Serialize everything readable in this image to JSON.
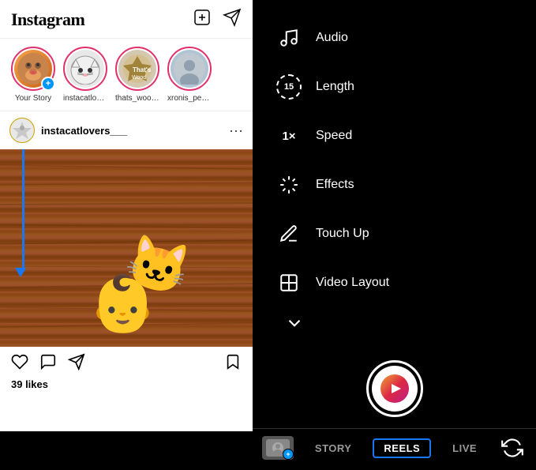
{
  "left": {
    "logo": "Instagram",
    "topbar": {
      "new_post_icon": "plus-square-icon",
      "send_icon": "send-icon"
    },
    "stories": [
      {
        "id": "your-story",
        "label": "Your Story",
        "has_ring": true,
        "has_add": true,
        "emoji": "🐕"
      },
      {
        "id": "instacatlovers",
        "label": "instacatlovers...",
        "has_ring": true,
        "has_add": false,
        "emoji": "🐱"
      },
      {
        "id": "thats_wood",
        "label": "thats_wood...",
        "has_ring": true,
        "has_add": false,
        "emoji": "⛏"
      },
      {
        "id": "xronis_pegk",
        "label": "xronis_pegk_...",
        "has_ring": true,
        "has_add": false,
        "emoji": "👤"
      }
    ],
    "post": {
      "username": "instacatlovers___",
      "likes": "39 likes"
    }
  },
  "right": {
    "controls": [
      {
        "id": "audio",
        "label": "Audio",
        "icon": "music-icon"
      },
      {
        "id": "length",
        "label": "Length",
        "icon": "length-icon",
        "value": "15"
      },
      {
        "id": "speed",
        "label": "Speed",
        "icon": "speed-icon",
        "value": "1×"
      },
      {
        "id": "effects",
        "label": "Effects",
        "icon": "effects-icon"
      },
      {
        "id": "touchup",
        "label": "Touch Up",
        "icon": "touchup-icon"
      },
      {
        "id": "videolayout",
        "label": "Video Layout",
        "icon": "videolayout-icon"
      }
    ],
    "chevron_label": "chevron-down",
    "bottom_tabs": [
      {
        "id": "story",
        "label": "STORY",
        "active": false
      },
      {
        "id": "reels",
        "label": "REELS",
        "active": true
      },
      {
        "id": "live",
        "label": "LIVE",
        "active": false
      }
    ],
    "flip_icon": "flip-camera-icon"
  },
  "colors": {
    "accent_blue": "#1877f2",
    "instagram_gradient_start": "#f09433",
    "instagram_gradient_end": "#bc1888"
  }
}
